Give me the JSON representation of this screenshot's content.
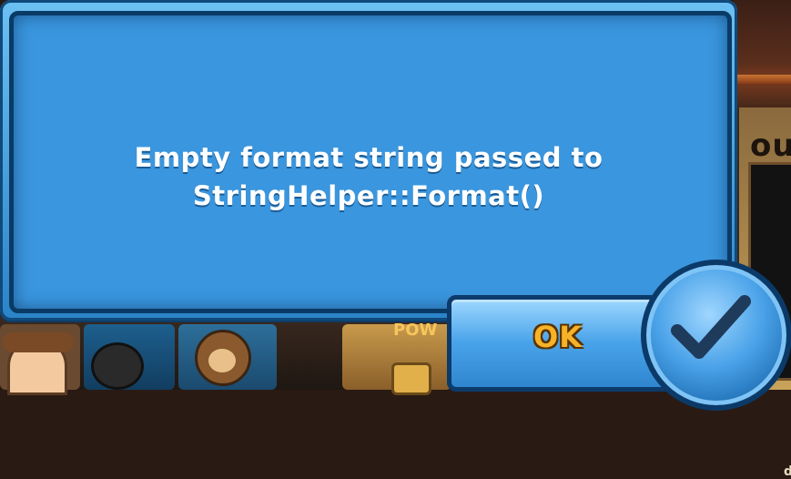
{
  "dialog": {
    "message_line1": "Empty format string passed to",
    "message_line2": "StringHelper::Format()",
    "ok_label": "OK",
    "confirm_icon": "checkmark-icon"
  },
  "background": {
    "right_panel_word": "out",
    "right_panel_small": "d",
    "pow_text": "POW"
  },
  "colors": {
    "dialog_fill": "#3a96de",
    "dialog_border": "#0a3a66",
    "ok_text": "#f6b328",
    "check_color": "#1e3b5c"
  }
}
